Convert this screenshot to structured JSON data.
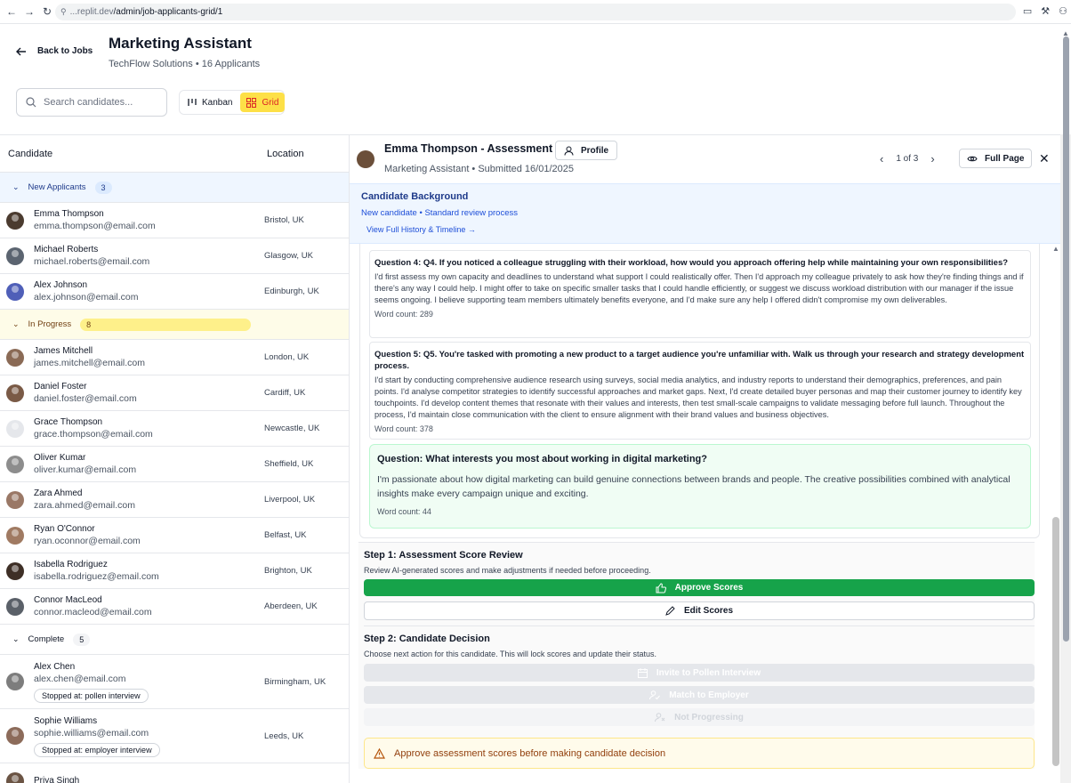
{
  "browser": {
    "url_host": "...replit.dev",
    "url_path": "/admin/job-applicants-grid/1"
  },
  "header": {
    "back_label": "Back to Jobs",
    "title": "Marketing Assistant",
    "subtitle": "TechFlow Solutions • 16 Applicants",
    "search_placeholder": "Search candidates...",
    "view_kanban": "Kanban",
    "view_grid": "Grid"
  },
  "table": {
    "col_candidate": "Candidate",
    "col_location": "Location",
    "groups": {
      "new": {
        "label": "New Applicants",
        "count": "3"
      },
      "progress": {
        "label": "In Progress",
        "count": "8"
      },
      "complete": {
        "label": "Complete",
        "count": "5"
      }
    },
    "new_rows": [
      {
        "name": "Emma Thompson",
        "email": "emma.thompson@email.com",
        "location": "Bristol, UK"
      },
      {
        "name": "Michael Roberts",
        "email": "michael.roberts@email.com",
        "location": "Glasgow, UK"
      },
      {
        "name": "Alex Johnson",
        "email": "alex.johnson@email.com",
        "location": "Edinburgh, UK"
      }
    ],
    "progress_rows": [
      {
        "name": "James Mitchell",
        "email": "james.mitchell@email.com",
        "location": "London, UK"
      },
      {
        "name": "Daniel Foster",
        "email": "daniel.foster@email.com",
        "location": "Cardiff, UK"
      },
      {
        "name": "Grace Thompson",
        "email": "grace.thompson@email.com",
        "location": "Newcastle, UK"
      },
      {
        "name": "Oliver Kumar",
        "email": "oliver.kumar@email.com",
        "location": "Sheffield, UK"
      },
      {
        "name": "Zara Ahmed",
        "email": "zara.ahmed@email.com",
        "location": "Liverpool, UK"
      },
      {
        "name": "Ryan O'Connor",
        "email": "ryan.oconnor@email.com",
        "location": "Belfast, UK"
      },
      {
        "name": "Isabella Rodriguez",
        "email": "isabella.rodriguez@email.com",
        "location": "Brighton, UK"
      },
      {
        "name": "Connor MacLeod",
        "email": "connor.macleod@email.com",
        "location": "Aberdeen, UK"
      }
    ],
    "complete_rows": [
      {
        "name": "Alex Chen",
        "email": "alex.chen@email.com",
        "location": "Birmingham, UK",
        "stopped": "Stopped at: pollen interview"
      },
      {
        "name": "Sophie Williams",
        "email": "sophie.williams@email.com",
        "location": "Leeds, UK",
        "stopped": "Stopped at: employer interview"
      },
      {
        "name": "Priya Singh",
        "email": "",
        "location": "",
        "stopped": ""
      }
    ]
  },
  "detail": {
    "title": "Emma Thompson - Assessment",
    "profile_btn": "Profile",
    "subtitle": "Marketing Assistant • Submitted 16/01/2025",
    "pager": "1 of 3",
    "full_page": "Full Page",
    "background_title": "Candidate Background",
    "background_sub": "New candidate • Standard review process",
    "history_link": "View Full History & Timeline →",
    "q4_title": "Question 4: Q4. If you noticed a colleague struggling with their workload, how would you approach offering help while maintaining your own responsibilities?",
    "q4_answer": "I'd first assess my own capacity and deadlines to understand what support I could realistically offer. Then I'd approach my colleague privately to ask how they're finding things and if there's any way I could help. I might offer to take on specific smaller tasks that I could handle efficiently, or suggest we discuss workload distribution with our manager if the issue seems ongoing. I believe supporting team members ultimately benefits everyone, and I'd make sure any help I offered didn't compromise my own deliverables.",
    "q4_wc": "Word count: 289",
    "q5_title": "Question 5: Q5. You're tasked with promoting a new product to a target audience you're unfamiliar with. Walk us through your research and strategy development process.",
    "q5_answer": "I'd start by conducting comprehensive audience research using surveys, social media analytics, and industry reports to understand their demographics, preferences, and pain points. I'd analyse competitor strategies to identify successful approaches and market gaps. Next, I'd create detailed buyer personas and map their customer journey to identify key touchpoints. I'd develop content themes that resonate with their values and interests, then test small-scale campaigns to validate messaging before full launch. Throughout the process, I'd maintain close communication with the client to ensure alignment with their brand values and business objectives.",
    "q5_wc": "Word count: 378",
    "q6_title": "Question: What interests you most about working in digital marketing?",
    "q6_answer": "I'm passionate about how digital marketing can build genuine connections between brands and people. The creative possibilities combined with analytical insights make every campaign unique and exciting.",
    "q6_wc": "Word count: 44",
    "step1_title": "Step 1: Assessment Score Review",
    "step1_desc": "Review AI-generated scores and make adjustments if needed before proceeding.",
    "approve_btn": "Approve Scores",
    "edit_btn": "Edit Scores",
    "step2_title": "Step 2: Candidate Decision",
    "step2_desc": "Choose next action for this candidate. This will lock scores and update their status.",
    "invite_btn": "Invite to Pollen Interview",
    "match_btn": "Match to Employer",
    "not_progressing_btn": "Not Progressing",
    "warning": "Approve assessment scores before making candidate decision"
  },
  "colors": {
    "accent_green": "#16a34a",
    "grid_active": "#fde047",
    "new_group_bg": "#eff6ff",
    "progress_group_bg": "#fefce8"
  }
}
